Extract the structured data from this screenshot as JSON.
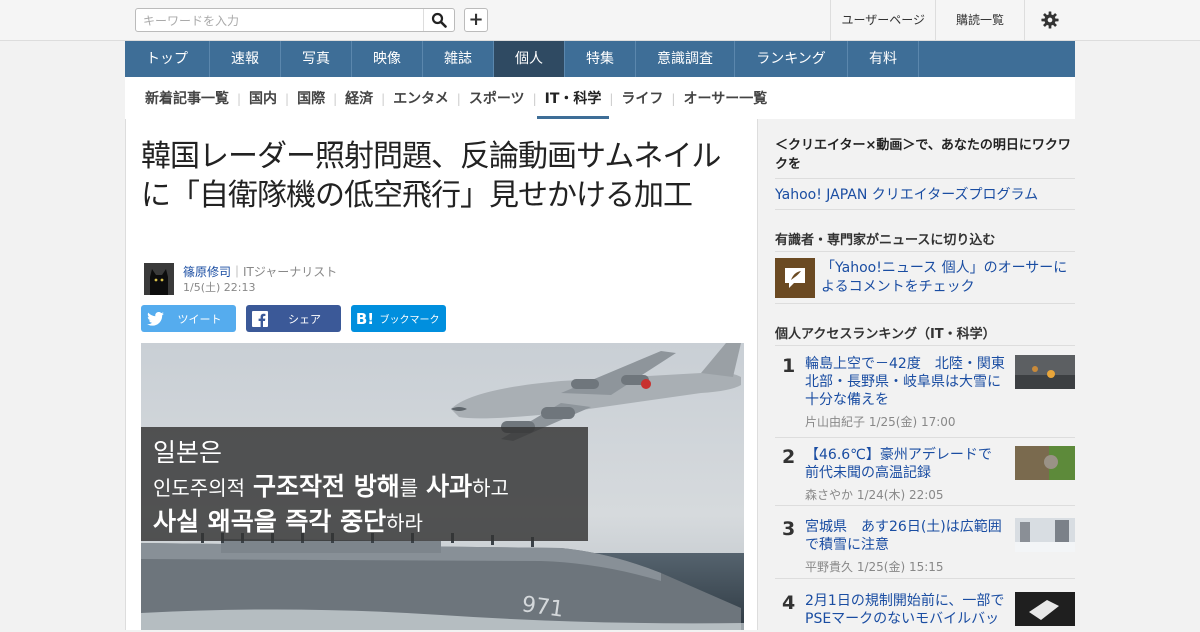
{
  "header": {
    "search_placeholder": "キーワードを入力",
    "user_page": "ユーザーページ",
    "subscriptions": "購読一覧"
  },
  "mainnav": [
    "トップ",
    "速報",
    "写真",
    "映像",
    "雑誌",
    "個人",
    "特集",
    "意識調査",
    "ランキング",
    "有料"
  ],
  "mainnav_active": "個人",
  "subnav": [
    "新着記事一覧",
    "国内",
    "国際",
    "経済",
    "エンタメ",
    "スポーツ",
    "IT・科学",
    "ライフ",
    "オーサー一覧"
  ],
  "subnav_active": "IT・科学",
  "article": {
    "title": "韓国レーダー照射問題、反論動画サムネイルに「自衛隊機の低空飛行」見せかける加工",
    "author_name": "篠原修司",
    "author_role": "｜ITジャーナリスト",
    "date": "1/5(土) 22:13",
    "share_twitter": "ツイート",
    "share_facebook": "シェア",
    "share_hatena": "ブックマーク",
    "hatena_logo": "B!",
    "photo_caption_line1": "일본은",
    "photo_caption_line2_a": "인도주의적",
    "photo_caption_line2_b": "구조작전 방해",
    "photo_caption_line2_c": "를",
    "photo_caption_line2_d": "사과",
    "photo_caption_line2_e": "하고",
    "photo_caption_line3_a": "사실 왜곡을 즉각 중단",
    "photo_caption_line3_b": "하라",
    "ship_number": "971"
  },
  "sidebar": {
    "promo_title": "＜クリエイター×動画＞で、あなたの明日にワクワクを",
    "promo_link": "Yahoo! JAPAN クリエイターズプログラム",
    "experts_heading": "有識者・専門家がニュースに切り込む",
    "experts_link": "「Yahoo!ニュース 個人」のオーサーによるコメントをチェック",
    "ranking_heading": "個人アクセスランキング（IT・科学）",
    "ranking": [
      {
        "num": "1",
        "title": "輪島上空で－42度　北陸・関東北部・長野県・岐阜県は大雪に十分な備えを",
        "meta": "片山由紀子  1/25(金) 17:00"
      },
      {
        "num": "2",
        "title": "【46.6℃】豪州アデレードで前代未聞の高温記録",
        "meta": "森さやか  1/24(木) 22:05"
      },
      {
        "num": "3",
        "title": "宮城県　あす26日(土)は広範囲で積雪に注意",
        "meta": "平野貴久  1/25(金) 15:15"
      },
      {
        "num": "4",
        "title": "2月1日の規制開始前に、一部でPSEマークのないモバイルバッ",
        "meta": ""
      }
    ]
  }
}
